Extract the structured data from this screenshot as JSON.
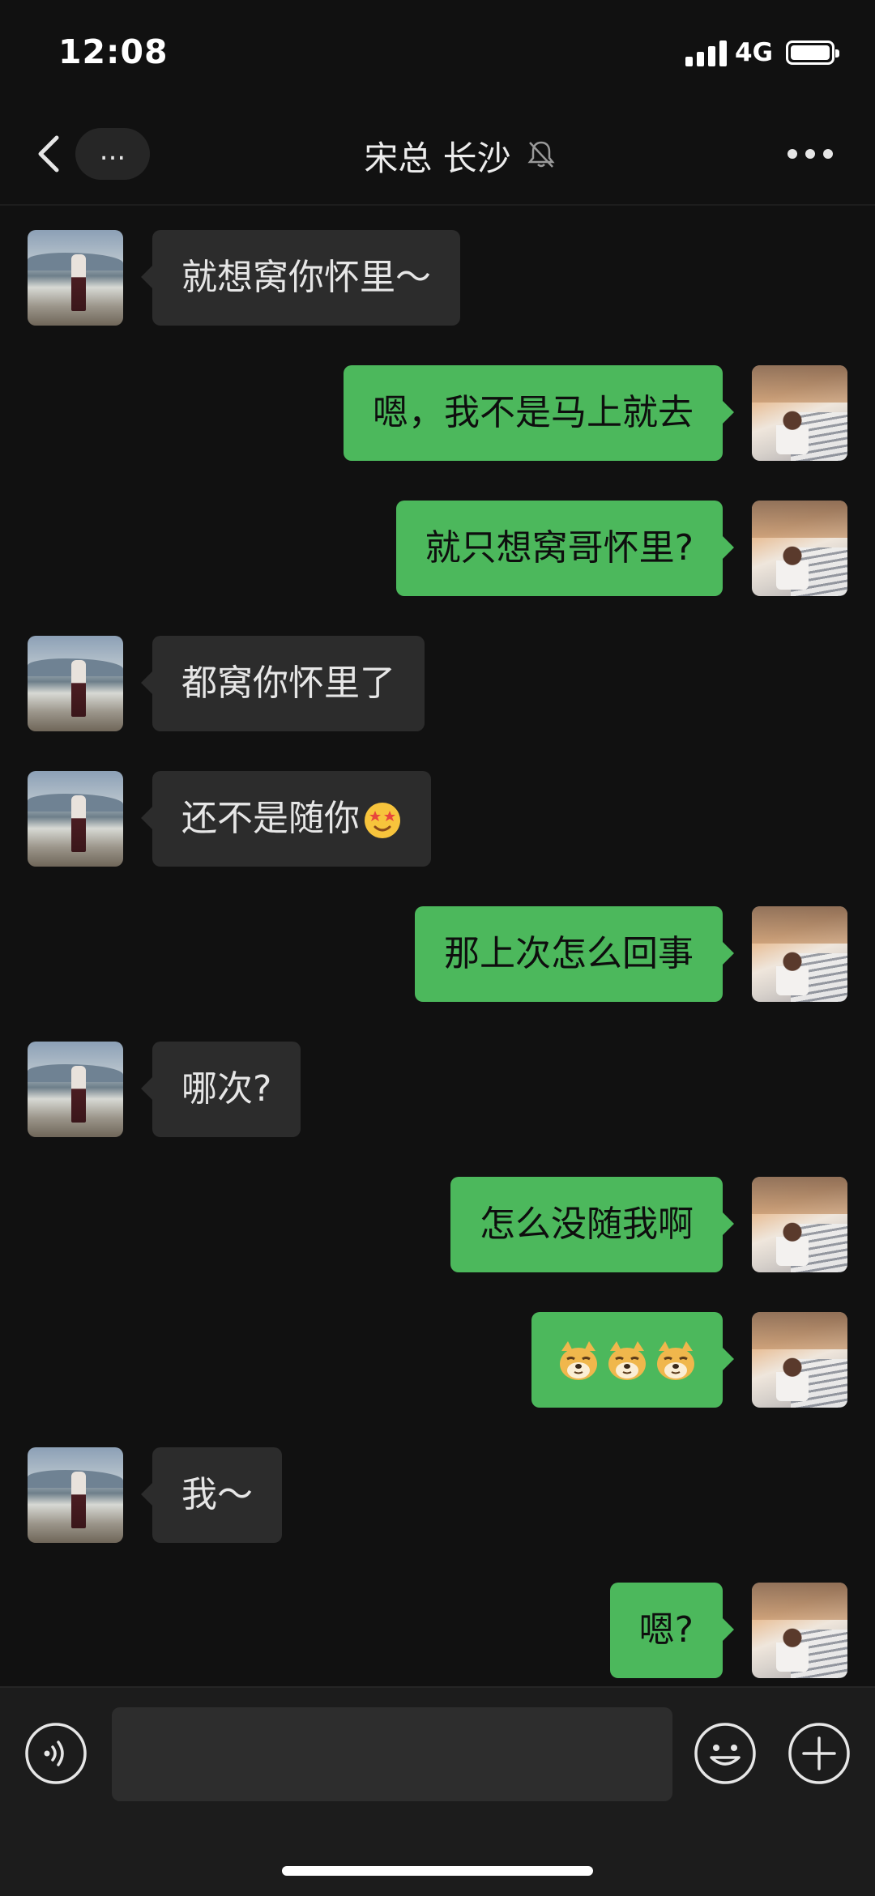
{
  "status_bar": {
    "time": "12:08",
    "network": "4G"
  },
  "nav": {
    "title": "宋总 长沙",
    "more_label": "...",
    "muted": true
  },
  "messages": [
    {
      "side": "left",
      "text": "就想窝你怀里～"
    },
    {
      "side": "right",
      "text": "嗯，我不是马上就去"
    },
    {
      "side": "right",
      "text": "就只想窝哥怀里?"
    },
    {
      "side": "left",
      "text": "都窝你怀里了"
    },
    {
      "side": "left",
      "text": "还不是随你",
      "emoji": "star-eyes-emoji"
    },
    {
      "side": "right",
      "text": "那上次怎么回事"
    },
    {
      "side": "left",
      "text": "哪次?"
    },
    {
      "side": "right",
      "text": "怎么没随我啊"
    },
    {
      "side": "right",
      "text": "",
      "stickers": [
        "doge-emoji",
        "doge-emoji",
        "doge-emoji"
      ]
    },
    {
      "side": "left",
      "text": "我～"
    },
    {
      "side": "right",
      "text": "嗯?"
    }
  ],
  "input_bar": {
    "placeholder": ""
  },
  "colors": {
    "background": "#111111",
    "bubble_left": "#2c2c2c",
    "bubble_right": "#4cb85c",
    "input_bar": "#1c1c1c"
  }
}
